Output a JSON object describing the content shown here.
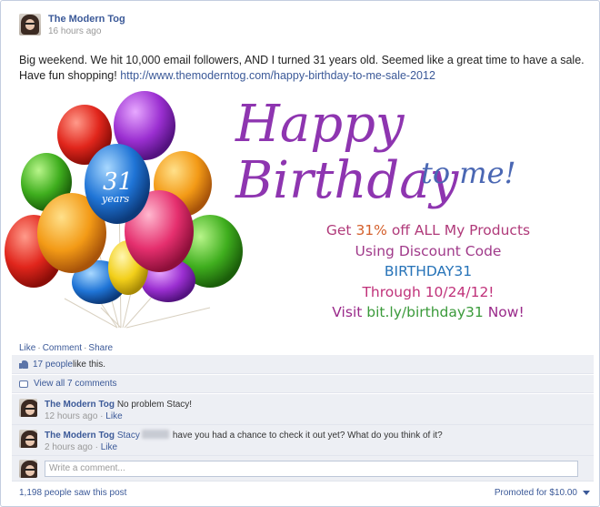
{
  "post": {
    "author": "The Modern Tog",
    "time": "16 hours ago",
    "text": "Big weekend. We hit 10,000 email followers, AND I turned 31 years old. Seemed like a great time to have a sale. Have fun shopping!",
    "link": "http://www.themoderntog.com/happy-birthday-to-me-sale-2012"
  },
  "promo": {
    "headline": "Happy Birthday",
    "subheadline": "to me!",
    "balloon_age": "31",
    "balloon_years": "years",
    "line1_prefix": "Get ",
    "line1_percent": "31%",
    "line1_suffix": " off ALL My Products",
    "line2": "Using Discount Code",
    "line3": "BIRTHDAY31",
    "line4": "Through 10/24/12!",
    "line5_prefix": "Visit ",
    "line5_link": "bit.ly/birthday31",
    "line5_suffix": " Now!"
  },
  "actions": {
    "like": "Like",
    "comment": "Comment",
    "share": "Share",
    "separator": "·"
  },
  "likes": {
    "people": "17 people",
    "suffix": " like this."
  },
  "view_comments": "View all 7 comments",
  "comments": [
    {
      "author": "The Modern Tog",
      "text": "No problem Stacy!",
      "time": "12 hours ago",
      "like": "Like",
      "separator": "·"
    },
    {
      "author": "The Modern Tog",
      "mention": "Stacy",
      "text": "have you had a chance to check it out yet? What do you think of it?",
      "time": "2 hours ago",
      "like": "Like",
      "separator": "·"
    }
  ],
  "write_comment_placeholder": "Write a comment...",
  "footer": {
    "seen": "1,198 people saw this post",
    "promoted": "Promoted for $10.00"
  },
  "colors": {
    "link_blue": "#3b5998",
    "ufi_bg": "#edeff4",
    "headline_purple": "#8e35b0",
    "code_blue": "#2673b8"
  }
}
